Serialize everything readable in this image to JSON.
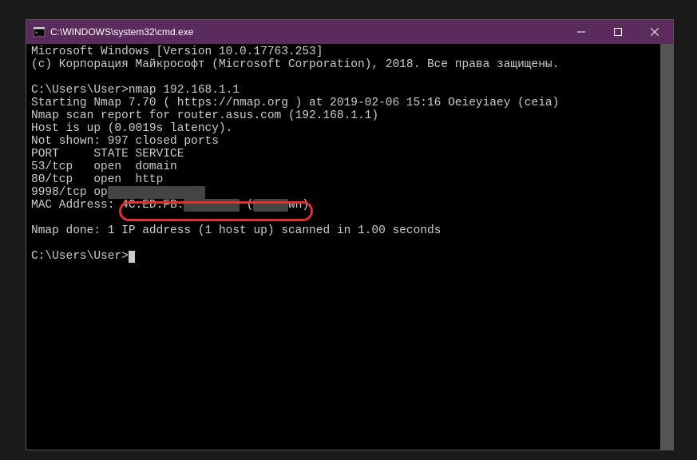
{
  "window": {
    "title": "C:\\WINDOWS\\system32\\cmd.exe"
  },
  "terminal": {
    "line1": "Microsoft Windows [Version 10.0.17763.253]",
    "line2": "(c) Корпорация Майкрософт (Microsoft Corporation), 2018. Все права защищены.",
    "line3": "",
    "prompt1": "C:\\Users\\User>",
    "command1": "nmap 192.168.1.1",
    "line5": "Starting Nmap 7.70 ( https://nmap.org ) at 2019-02-06 15:16 Oeieyiaey (ceia)",
    "line6": "Nmap scan report for router.asus.com (192.168.1.1)",
    "line7": "Host is up (0.0019s latency).",
    "line8": "Not shown: 997 closed ports",
    "line9": "PORT     STATE SERVICE",
    "line10": "53/tcp   open  domain",
    "line11": "80/tcp   open  http",
    "line12_pre": "9998/tcp op",
    "mac_label": "MAC Address:",
    "mac_visible": " 4C:ED:FB:",
    "mac_paren_open": " (",
    "mac_suffix": "wn)",
    "line15": "Nmap done: 1 IP address (1 host up) scanned in 1.00 seconds",
    "prompt2": "C:\\Users\\User>"
  }
}
